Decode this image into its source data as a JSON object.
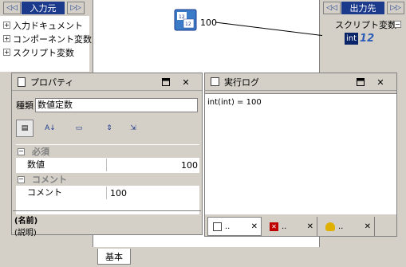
{
  "left_panel": {
    "nav_prev": "◁◁",
    "title": "入力元",
    "nav_next": "▷▷",
    "tree_items": [
      {
        "expander": "+",
        "label": "入力ドキュメント"
      },
      {
        "expander": "+",
        "label": "コンポーネント変数"
      },
      {
        "expander": "+",
        "label": "スクリプト変数"
      }
    ]
  },
  "right_panel": {
    "nav_prev": "◁◁",
    "title": "出力先",
    "nav_next": "▷▷",
    "tree_root": "スクリプト変数",
    "tree_root_expander": "−",
    "var_label": "int",
    "var_type_icon": "12"
  },
  "canvas": {
    "node_value": "100",
    "node_icon": "numeric-constant-icon",
    "connection_color": "#000000"
  },
  "properties": {
    "title": "プロパティ",
    "kind_label": "種類",
    "kind_value": "数値定数",
    "sections": [
      {
        "expander": "−",
        "name": "必須",
        "rows": [
          {
            "key": "数値",
            "value": "100"
          }
        ]
      },
      {
        "expander": "−",
        "name": "コメント",
        "rows": [
          {
            "key": "コメント",
            "value": "100"
          }
        ]
      }
    ],
    "footer_name": "(名前)",
    "footer_desc": "(説明)"
  },
  "log": {
    "title": "実行ログ",
    "lines": [
      "int(int) = 100"
    ],
    "tabs": [
      {
        "label": "..",
        "close": "✕"
      },
      {
        "label": "..",
        "close": "✕"
      },
      {
        "label": "..",
        "close": "✕"
      }
    ]
  },
  "bottom_tab": {
    "label": "基本"
  },
  "colors": {
    "nav_blue": "#1c3a8c",
    "selection": "#0a246a",
    "accent_red": "#c00000"
  }
}
